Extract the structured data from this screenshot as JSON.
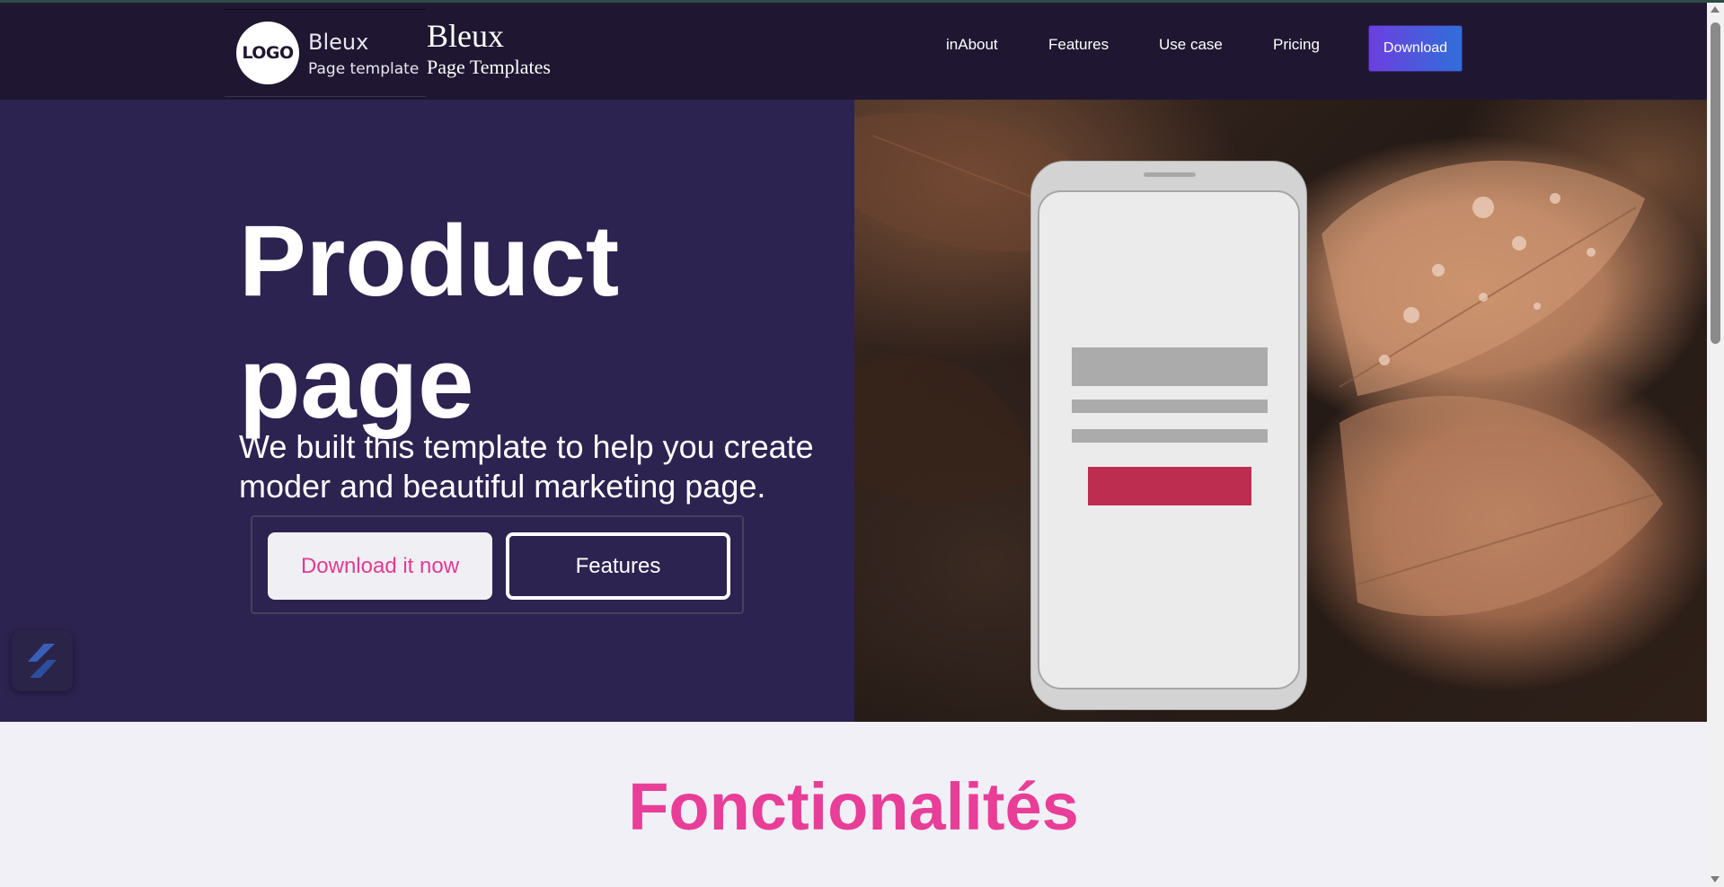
{
  "header": {
    "logo_text": "LOGO",
    "logo_name": "Bleux",
    "logo_subtitle": "Page template",
    "brand_title": "Bleux",
    "brand_subtitle": "Page Templates",
    "nav": [
      {
        "label": "inAbout"
      },
      {
        "label": "Features"
      },
      {
        "label": "Use case"
      },
      {
        "label": "Pricing"
      }
    ],
    "download_label": "Download"
  },
  "hero": {
    "title": "Product page",
    "description": "We built this template to help you create moder and beautiful marketing page.",
    "primary_button": "Download it now",
    "secondary_button": "Features"
  },
  "section": {
    "title": "Fonctionalités"
  },
  "colors": {
    "header_bg": "#1f1731",
    "hero_bg": "#2c2350",
    "accent_pink": "#e83e97",
    "phone_cta": "#bd2d4f"
  },
  "icons": [
    "widget-logo-icon",
    "scroll-up-icon",
    "scroll-down-icon"
  ]
}
